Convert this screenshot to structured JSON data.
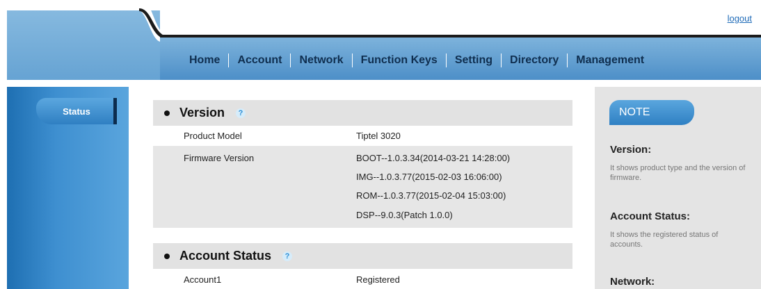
{
  "header": {
    "logout_label": "logout",
    "nav": [
      "Home",
      "Account",
      "Network",
      "Function Keys",
      "Setting",
      "Directory",
      "Management"
    ]
  },
  "sidebar": {
    "status_label": "Status"
  },
  "version": {
    "title": "Version",
    "rows": [
      {
        "label": "Product Model",
        "values": [
          "Tiptel 3020"
        ]
      },
      {
        "label": "Firmware Version",
        "values": [
          "BOOT--1.0.3.34(2014-03-21 14:28:00)",
          "IMG--1.0.3.77(2015-02-03 16:06:00)",
          "ROM--1.0.3.77(2015-02-04 15:03:00)",
          "DSP--9.0.3(Patch 1.0.0)"
        ]
      }
    ]
  },
  "account_status": {
    "title": "Account Status",
    "rows": [
      {
        "label": "Account1",
        "value": "Registered"
      }
    ]
  },
  "note": {
    "tab_label": "NOTE",
    "items": [
      {
        "heading": "Version:",
        "text": "It shows product type and the version of firmware."
      },
      {
        "heading": "Account Status:",
        "text": "It shows the registered status of accounts."
      },
      {
        "heading": "Network:",
        "text": ""
      }
    ]
  }
}
